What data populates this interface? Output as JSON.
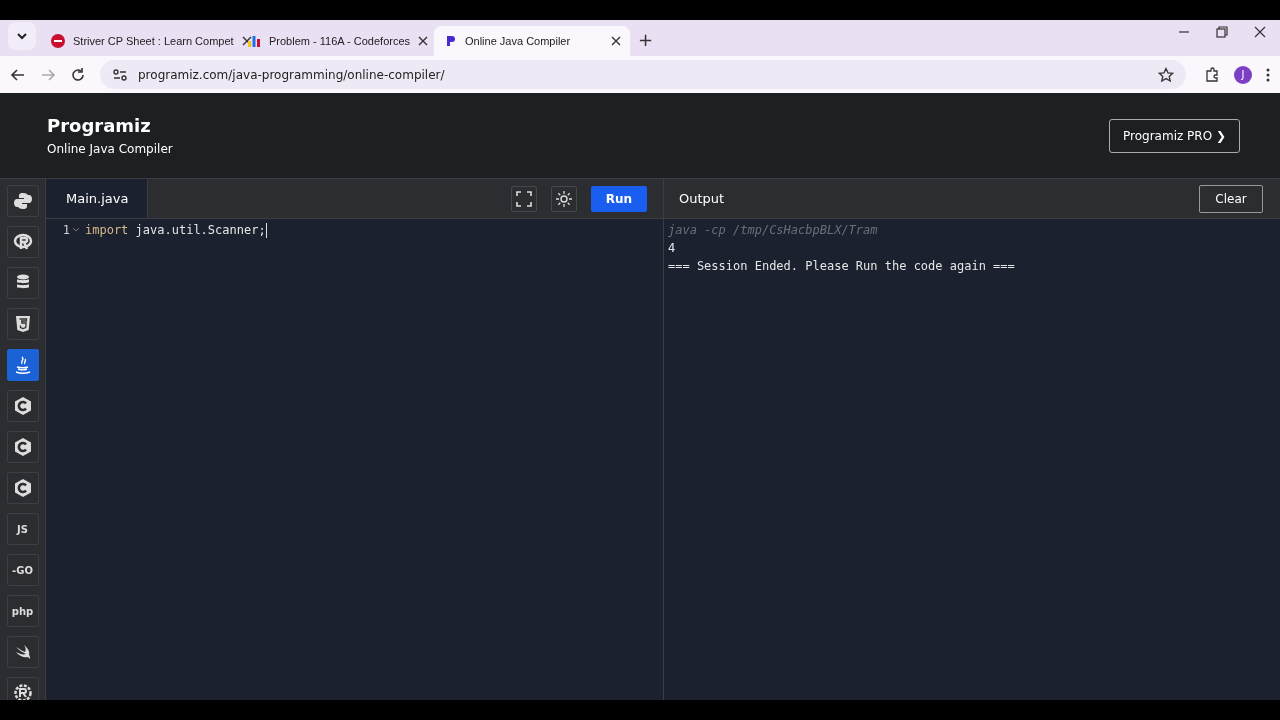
{
  "browser": {
    "tabs": [
      {
        "title": "Striver CP Sheet : Learn Compet",
        "selected": false
      },
      {
        "title": "Problem - 116A - Codeforces",
        "selected": false
      },
      {
        "title": "Online Java Compiler",
        "selected": true
      }
    ],
    "new_tab": "+",
    "address": "programiz.com/java-programming/online-compiler/",
    "profile": "J"
  },
  "header": {
    "logo": "Programiz",
    "subtitle": "Online Java Compiler",
    "pro_button": "Programiz PRO ❯"
  },
  "sidebar": {
    "items": [
      {
        "kind": "python",
        "selected": false
      },
      {
        "kind": "r",
        "selected": false
      },
      {
        "kind": "sql",
        "selected": false
      },
      {
        "kind": "html",
        "selected": false
      },
      {
        "kind": "java",
        "selected": true
      },
      {
        "kind": "c",
        "selected": false
      },
      {
        "kind": "c",
        "selected": false
      },
      {
        "kind": "c",
        "selected": false
      },
      {
        "kind": "text",
        "label": "JS",
        "selected": false
      },
      {
        "kind": "text",
        "label": "-GO",
        "selected": false
      },
      {
        "kind": "text",
        "label": "php",
        "selected": false
      },
      {
        "kind": "swift",
        "selected": false
      },
      {
        "kind": "rust",
        "selected": false
      }
    ]
  },
  "editor": {
    "file_tab": "Main.java",
    "run_button": "Run",
    "lines": [
      {
        "number": "1",
        "tokens": [
          {
            "kind": "keyword",
            "text": "import"
          },
          {
            "kind": "plain",
            "text": " java.util.Scanner;"
          }
        ]
      }
    ]
  },
  "output": {
    "title": "Output",
    "clear_button": "Clear",
    "lines": [
      {
        "kind": "command",
        "text": "java -cp /tmp/CsHacbpBLX/Tram"
      },
      {
        "kind": "stdout",
        "text": "4"
      },
      {
        "kind": "info",
        "text": "=== Session Ended. Please Run the code again ==="
      }
    ]
  }
}
